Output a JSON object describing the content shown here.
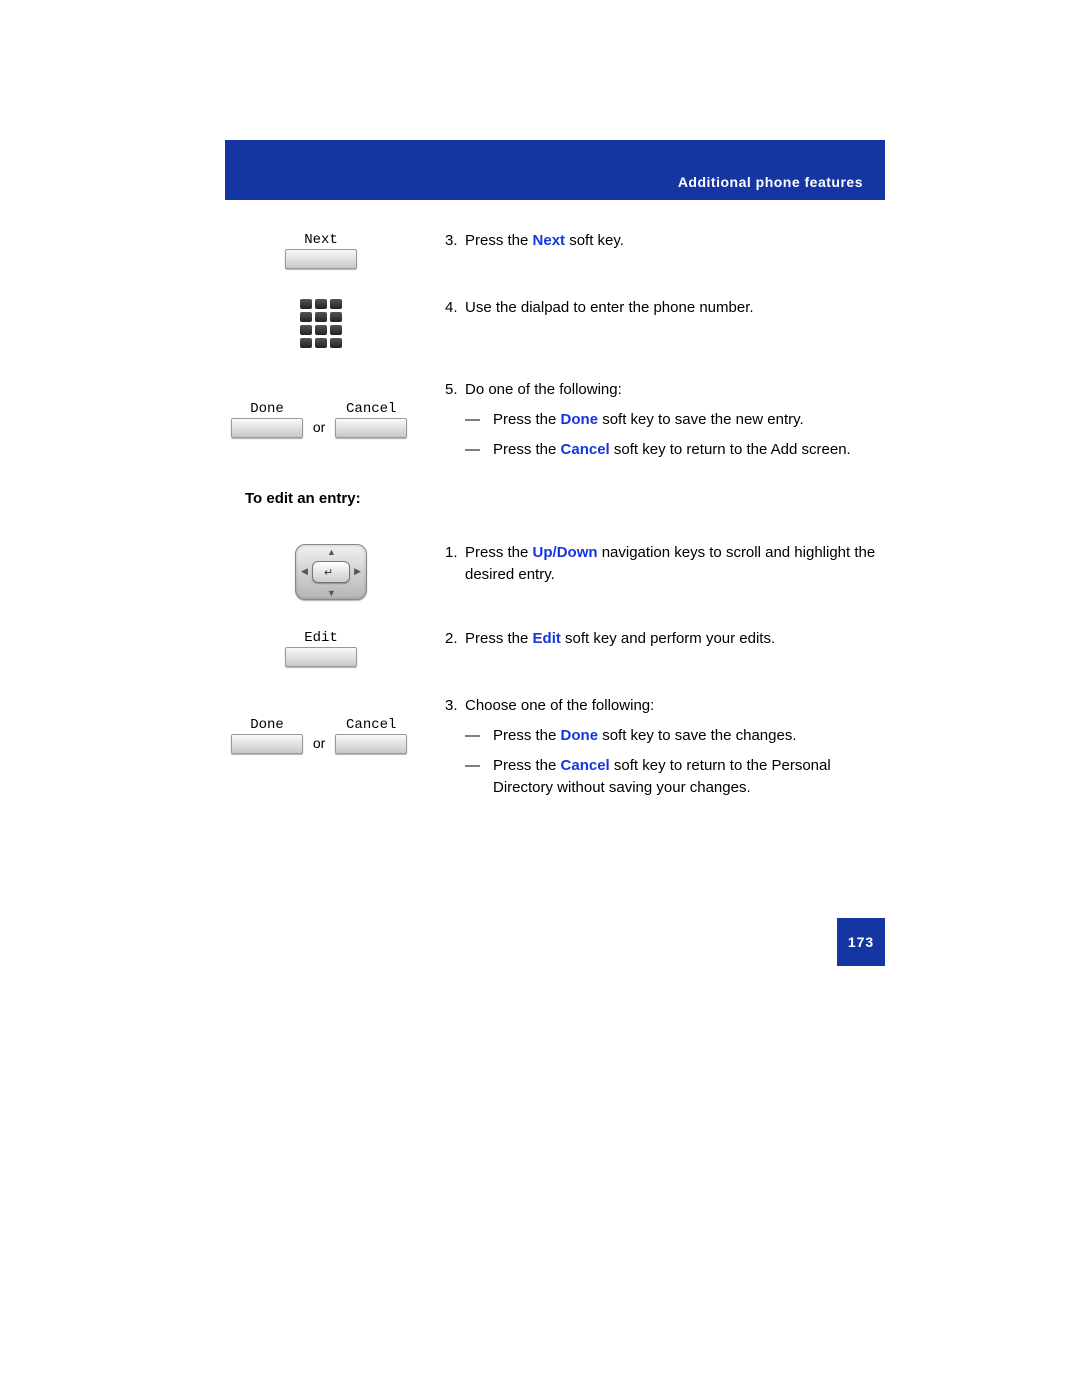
{
  "header": {
    "title": "Additional phone features"
  },
  "softkeys": {
    "next": "Next",
    "done": "Done",
    "cancel": "Cancel",
    "edit": "Edit",
    "or": "or"
  },
  "stepsA": {
    "s3": {
      "num": "3.",
      "pre": "Press the ",
      "key": "Next",
      "post": " soft key."
    },
    "s4": {
      "num": "4.",
      "text": "Use the dialpad to enter the phone number."
    },
    "s5": {
      "num": "5.",
      "lead": "Do one of the following:",
      "a": {
        "pre": "Press the ",
        "key": "Done",
        "post": " soft key to save the new entry."
      },
      "b": {
        "pre": "Press the ",
        "key": "Cancel",
        "post": " soft key to return to the Add screen."
      }
    }
  },
  "editHeading": "To edit an entry:",
  "stepsB": {
    "s1": {
      "num": "1.",
      "pre": "Press the ",
      "key": "Up/Down",
      "post": " navigation keys to scroll and highlight the desired entry."
    },
    "s2": {
      "num": "2.",
      "pre": "Press the ",
      "key": "Edit",
      "post": " soft key and perform your edits."
    },
    "s3": {
      "num": "3.",
      "lead": "Choose one of the following:",
      "a": {
        "pre": "Press the ",
        "key": "Done",
        "post": " soft key to save the changes."
      },
      "b": {
        "pre": "Press the ",
        "key": "Cancel",
        "post": " soft key to return to the Personal Directory without saving your changes."
      }
    }
  },
  "dash": "—",
  "pageNumber": "173"
}
